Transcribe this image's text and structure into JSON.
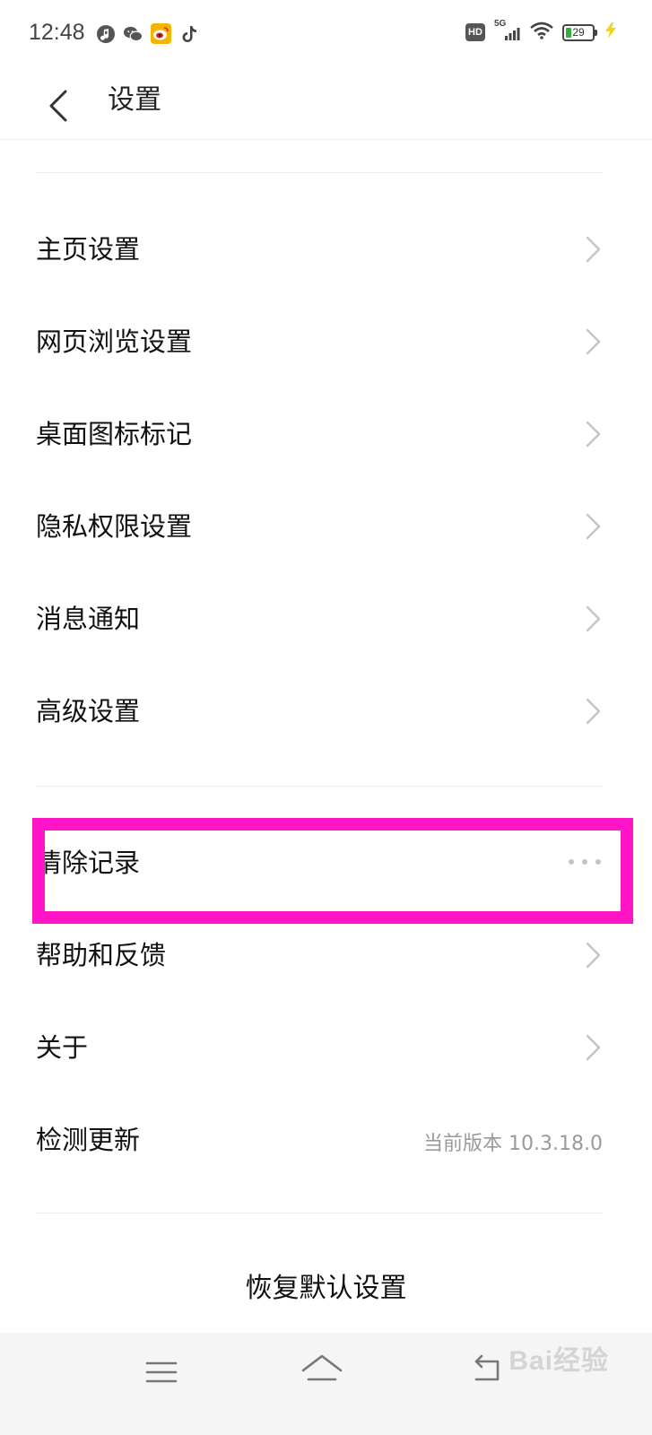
{
  "status_bar": {
    "time": "12:48",
    "hd": "HD",
    "network": "5G",
    "battery": "29",
    "app_icons": [
      "music-icon",
      "wechat-icon",
      "weibo-icon",
      "tiktok-icon"
    ]
  },
  "header": {
    "title": "设置"
  },
  "settings": {
    "group1": [
      {
        "label": "主页设置",
        "icon": "chevron-right-icon"
      },
      {
        "label": "网页浏览设置",
        "icon": "chevron-right-icon"
      },
      {
        "label": "桌面图标标记",
        "icon": "chevron-right-icon"
      },
      {
        "label": "隐私权限设置",
        "icon": "chevron-right-icon"
      },
      {
        "label": "消息通知",
        "icon": "chevron-right-icon"
      },
      {
        "label": "高级设置",
        "icon": "chevron-right-icon"
      }
    ],
    "group2": [
      {
        "label": "清除记录",
        "icon": "more-icon"
      },
      {
        "label": "帮助和反馈",
        "icon": "chevron-right-icon"
      },
      {
        "label": "关于",
        "icon": "chevron-right-icon"
      },
      {
        "label": "检测更新",
        "value": "当前版本 10.3.18.0"
      }
    ]
  },
  "restore_label": "恢复默认设置",
  "colors": {
    "highlight": "#ff14c8",
    "battery_fill": "#2fb13a",
    "secondary_text": "#9a9a9a"
  },
  "watermark": "Bai经验"
}
